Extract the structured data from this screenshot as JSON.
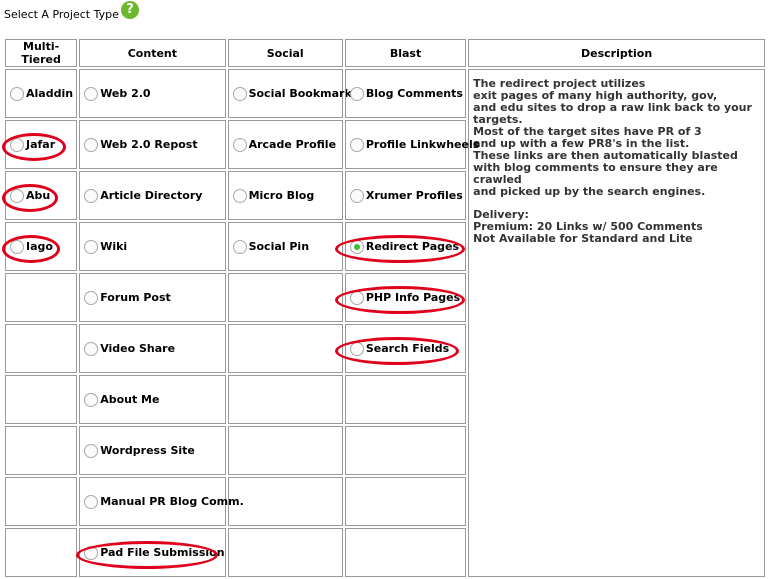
{
  "page": {
    "title": "Select A Project Type",
    "help_icon_glyph": "?"
  },
  "table": {
    "headers": [
      "Multi-Tiered",
      "Content",
      "Social",
      "Blast",
      "Description"
    ],
    "multi_tiered": [
      "Aladdin",
      "Jafar",
      "Abu",
      "Iago"
    ],
    "content": [
      "Web 2.0",
      "Web 2.0 Repost",
      "Article Directory",
      "Wiki",
      "Forum Post",
      "Video Share",
      "About Me",
      "Wordpress Site",
      "Manual PR Blog Comm.",
      "Pad File Submission"
    ],
    "social": [
      "Social Bookmarks",
      "Arcade Profile",
      "Micro Blog",
      "Social Pin"
    ],
    "blast": [
      "Blog Comments",
      "Profile Linkwheels",
      "Xrumer Profiles",
      "Redirect Pages",
      "PHP Info Pages",
      "Search Fields"
    ],
    "selected": "Redirect Pages"
  },
  "description": {
    "lines": [
      "The redirect project utilizes",
      "exit pages of many high authority, gov,",
      "and edu sites to drop a raw link back to your targets.",
      "Most of the target sites have PR of 3",
      "and up with a few PR8's in the list.",
      "These links are then automatically blasted",
      "with blog comments to ensure they are crawled",
      "and picked up by the search engines."
    ],
    "delivery_lines": [
      "Delivery:",
      "Premium: 20 Links w/ 500 Comments",
      "Not Available for Standard and Lite"
    ]
  },
  "colors": {
    "annotation_red": "#e0001b",
    "selected_radio": "#39c12f",
    "help_icon": "#6ab82d",
    "border": "#9a9a9a"
  }
}
